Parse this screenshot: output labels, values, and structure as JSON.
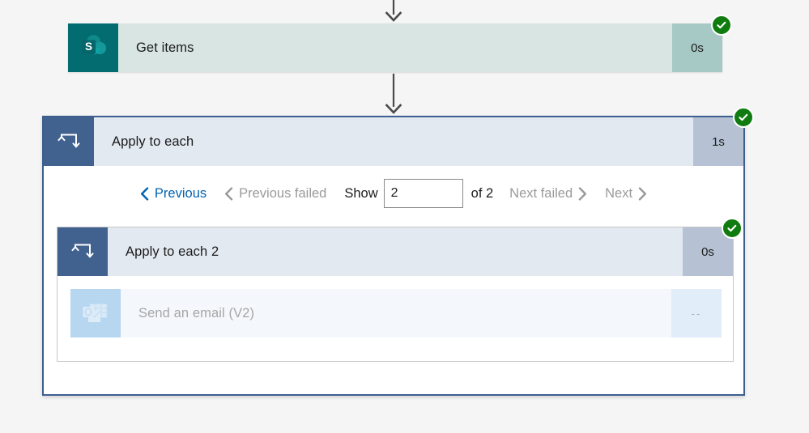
{
  "page": {
    "background_color": "#f5f5f5"
  },
  "colors": {
    "success_green": "#107c10",
    "link_blue": "#0063b1",
    "disabled_gray": "#9a9a9a",
    "scope_border_blue": "#3c5f8f",
    "sharepoint_teal": "#036c70",
    "loop_header_blue": "#41618f"
  },
  "connectors": [
    {
      "name": "connector-to-get-items",
      "icon": "arrow-down-icon"
    },
    {
      "name": "connector-to-apply-to-each",
      "icon": "arrow-down-icon"
    }
  ],
  "actions": {
    "get_items": {
      "title": "Get items",
      "duration": "0s",
      "status": "succeeded",
      "status_icon": "check-circle-icon",
      "connector_icon": "sharepoint-icon"
    },
    "apply_to_each": {
      "title": "Apply to each",
      "duration": "1s",
      "status": "succeeded",
      "status_icon": "check-circle-icon",
      "connector_icon": "loop-icon"
    },
    "apply_to_each_2": {
      "title": "Apply to each 2",
      "duration": "0s",
      "status": "succeeded",
      "status_icon": "check-circle-icon",
      "connector_icon": "loop-icon"
    },
    "send_an_email": {
      "title": "Send an email (V2)",
      "duration": "--",
      "status": "skipped",
      "connector_icon": "outlook-icon"
    }
  },
  "pager": {
    "previous_label": "Previous",
    "previous_enabled": true,
    "previous_failed_label": "Previous failed",
    "previous_failed_enabled": false,
    "show_label": "Show",
    "page_value": "2",
    "page_placeholder": "",
    "of_label": "of 2",
    "total_pages": "2",
    "next_failed_label": "Next failed",
    "next_failed_enabled": false,
    "next_label": "Next",
    "next_enabled": false,
    "chevron_left_icon": "chevron-left-icon",
    "chevron_right_icon": "chevron-right-icon"
  }
}
